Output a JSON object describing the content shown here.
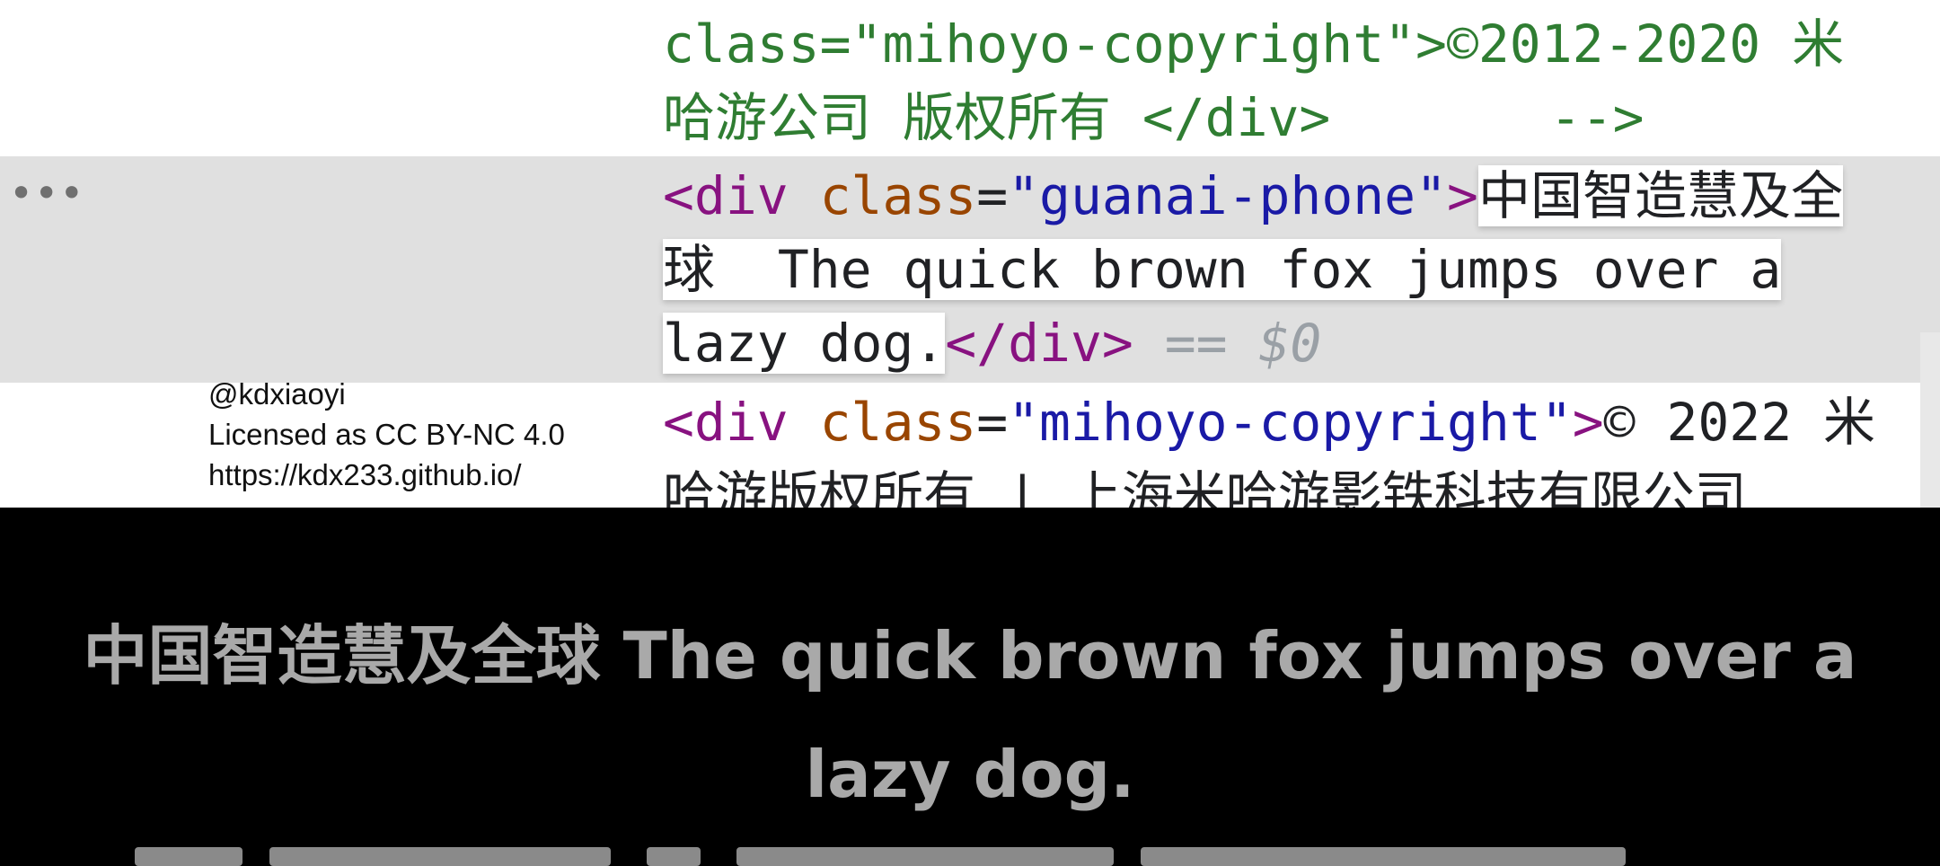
{
  "devtools": {
    "menu_icon": "more-options-icon",
    "lines": {
      "comment_line1": "class=\"mihoyo-copyright\">©2012-2020 米",
      "comment_line2": "哈游公司 版权所有 </div>       -->",
      "selected": {
        "open_lt": "<",
        "tag_name": "div",
        "attr_name": "class",
        "attr_eq": "=",
        "attr_value": "\"guanai-phone\"",
        "gt": ">",
        "text_part1": "中国智造慧及全",
        "text_part2": "球  The quick brown fox jumps over a",
        "text_part3": "lazy dog.",
        "close_tag": "</div>",
        "eq0": "== $0"
      },
      "next": {
        "open_lt": "<",
        "tag_name": "div",
        "attr_name": "class",
        "attr_eq": "=",
        "attr_value": "\"mihoyo-copyright\"",
        "gt": ">",
        "text": "© 2022 米",
        "cut_line": "哈游版权所有 | 上海米哈游影铁科技有限公司"
      }
    }
  },
  "watermark": {
    "handle": "@kdxiaoyi",
    "license": "Licensed as CC BY-NC 4.0",
    "url": "https://kdx233.github.io/"
  },
  "preview": {
    "line1": "中国智造慧及全球 The quick brown fox jumps over a",
    "line2": "lazy dog."
  },
  "colors": {
    "comment": "#2f7d32",
    "tag": "#881280",
    "attr": "#994500",
    "value": "#1a1aa6",
    "selected_row_bg": "#e0e0e0",
    "preview_bg": "#000000",
    "preview_text": "#a9a9a9"
  }
}
